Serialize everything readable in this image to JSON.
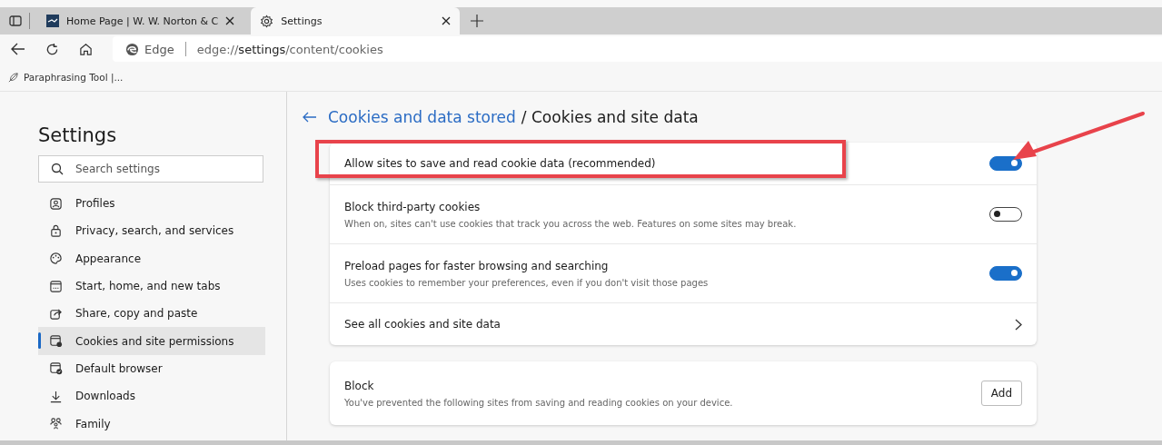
{
  "tabs": [
    {
      "title": "Home Page | W. W. Norton & C",
      "kind": "site",
      "selected": false
    },
    {
      "title": "Settings",
      "kind": "settings",
      "selected": true
    }
  ],
  "address_bar": {
    "site_label": "Edge",
    "url_prefix": "edge://",
    "url_host": "settings",
    "url_path": "/content/cookies"
  },
  "bookmarks": [
    {
      "label": "Paraphrasing Tool |..."
    }
  ],
  "sidebar": {
    "title": "Settings",
    "search": {
      "placeholder": "Search settings"
    },
    "items": [
      {
        "label": "Profiles",
        "selected": false
      },
      {
        "label": "Privacy, search, and services",
        "selected": false
      },
      {
        "label": "Appearance",
        "selected": false
      },
      {
        "label": "Start, home, and new tabs",
        "selected": false
      },
      {
        "label": "Share, copy and paste",
        "selected": false
      },
      {
        "label": "Cookies and site permissions",
        "selected": true
      },
      {
        "label": "Default browser",
        "selected": false
      },
      {
        "label": "Downloads",
        "selected": false
      },
      {
        "label": "Family",
        "selected": false
      }
    ]
  },
  "content": {
    "breadcrumb_link": "Cookies and data stored",
    "breadcrumb_separator": "/",
    "page_title": "Cookies and site data",
    "settings": [
      {
        "kind": "toggle",
        "title": "Allow sites to save and read cookie data (recommended)",
        "on": true,
        "highlighted": true
      },
      {
        "kind": "toggle",
        "title": "Block third-party cookies",
        "description": "When on, sites can't use cookies that track you across the web. Features on some sites may break.",
        "on": false,
        "highlighted": false
      },
      {
        "kind": "toggle",
        "title": "Preload pages for faster browsing and searching",
        "description": "Uses cookies to remember your preferences, even if you don't visit those pages",
        "on": true,
        "highlighted": false
      },
      {
        "kind": "link",
        "title": "See all cookies and site data",
        "highlighted": false
      }
    ],
    "block": {
      "title": "Block",
      "description": "You've prevented the following sites from saving and reading cookies on your device.",
      "button": "Add"
    }
  }
}
